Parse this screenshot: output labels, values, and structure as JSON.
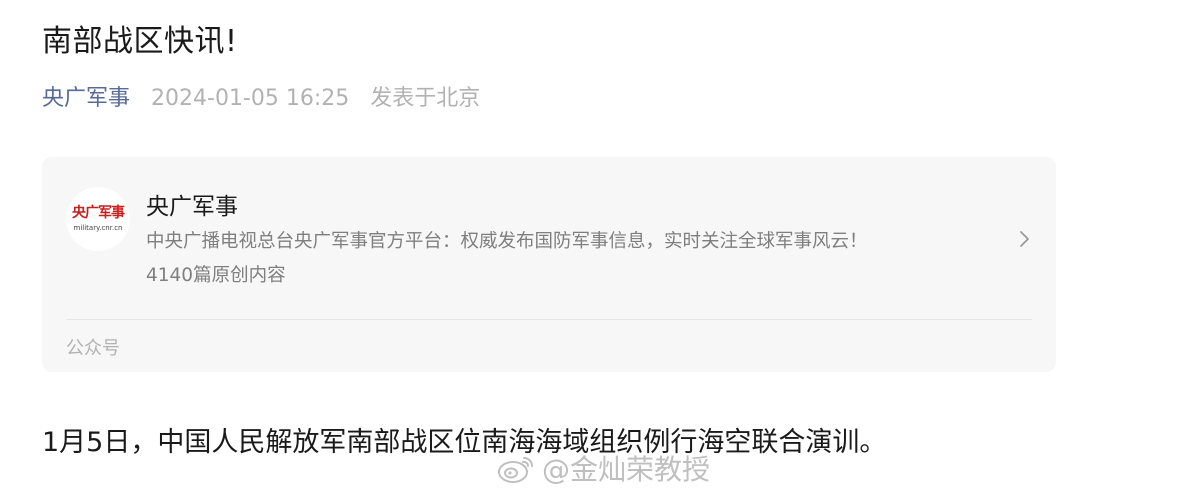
{
  "article": {
    "title": "南部战区快讯!",
    "author": "央广军事",
    "date": "2024-01-05 16:25",
    "location": "发表于北京",
    "body": "1月5日，中国人民解放军南部战区位南海海域组织例行海空联合演训。"
  },
  "account_card": {
    "avatar_logo_text": "央广军事",
    "avatar_logo_subtext": "military.cnr.cn",
    "name": "央广军事",
    "description": "中央广播电视总台央广军事官方平台：权威发布国防军事信息，实时关注全球军事风云！",
    "original_count": "4140篇原创内容",
    "type_label": "公众号",
    "chevron_icon": "chevron-right-icon"
  },
  "watermark": {
    "icon": "weibo-icon",
    "text": "@金灿荣教授"
  },
  "colors": {
    "author_link": "#576b95",
    "meta_gray": "#b2b2b2",
    "card_bg": "#f7f7f7",
    "logo_red": "#c81e1e"
  }
}
